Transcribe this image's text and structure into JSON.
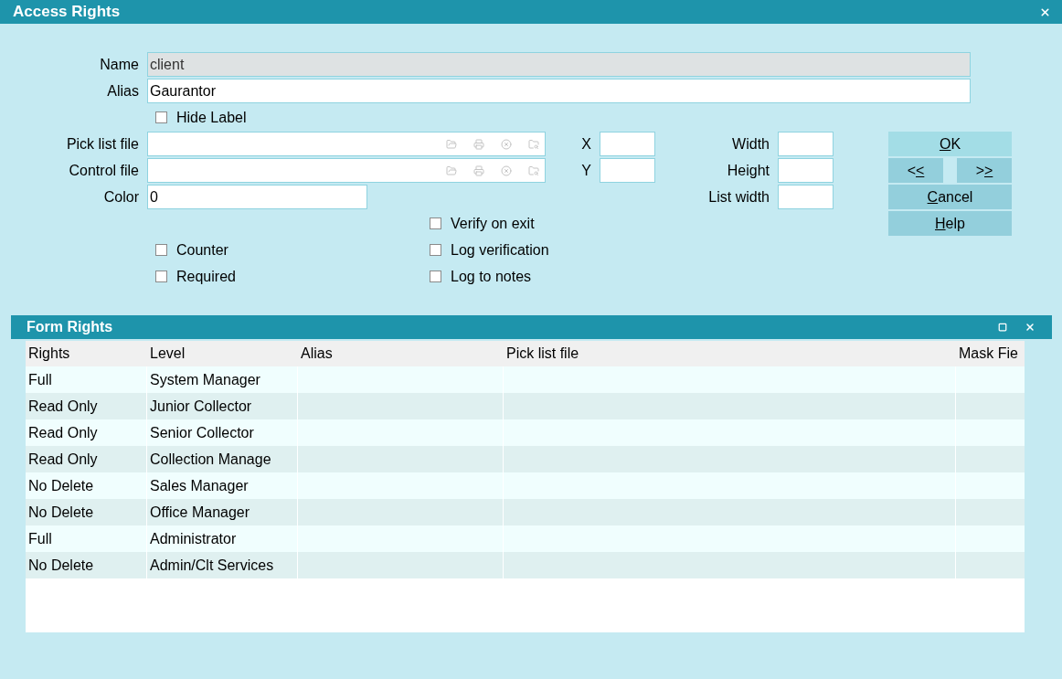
{
  "window": {
    "title": "Access Rights"
  },
  "name_field": {
    "label": "Name",
    "value": "client",
    "disabled": true
  },
  "alias_field": {
    "label": "Alias",
    "value": "Gaurantor",
    "disabled": false
  },
  "hide_label": {
    "label": "Hide Label",
    "checked": false
  },
  "pick_list_file": {
    "label": "Pick list file"
  },
  "control_file": {
    "label": "Control file"
  },
  "color_field": {
    "label": "Color",
    "value": "0"
  },
  "x_field": {
    "label": "X"
  },
  "y_field": {
    "label": "Y"
  },
  "width_field": {
    "label": "Width"
  },
  "height_field": {
    "label": "Height"
  },
  "list_width_field": {
    "label": "List width"
  },
  "checkboxes_left": [
    {
      "label": "Counter",
      "checked": false
    },
    {
      "label": "Required",
      "checked": false
    }
  ],
  "checkboxes_right": [
    {
      "label": "Verify on exit",
      "checked": false
    },
    {
      "label": "Log verification",
      "checked": false
    },
    {
      "label": "Log to notes",
      "checked": false
    }
  ],
  "button_rows": [
    [
      {
        "key": "O",
        "post": "K",
        "default": true
      }
    ],
    [
      {
        "pre": "<",
        "key": "<",
        "default": false
      },
      {
        "pre": ">",
        "key": ">",
        "default": false
      }
    ],
    [
      {
        "key": "C",
        "post": "ancel",
        "default": false
      }
    ],
    [
      {
        "key": "H",
        "post": "elp",
        "default": false
      }
    ]
  ],
  "form_rights": {
    "title": "Form Rights",
    "columns": [
      "Rights",
      "Level",
      "Alias",
      "Pick list file",
      "Mask Fie"
    ],
    "rows": [
      {
        "rights": "Full",
        "level": "System Manager"
      },
      {
        "rights": "Read Only",
        "level": "Junior Collector"
      },
      {
        "rights": "Read Only",
        "level": "Senior Collector"
      },
      {
        "rights": "Read Only",
        "level": "Collection Manage"
      },
      {
        "rights": "No Delete",
        "level": "Sales Manager"
      },
      {
        "rights": "No Delete",
        "level": "Office Manager"
      },
      {
        "rights": "Full",
        "level": "Administrator"
      },
      {
        "rights": "No Delete",
        "level": "Admin/Clt Services"
      }
    ]
  }
}
